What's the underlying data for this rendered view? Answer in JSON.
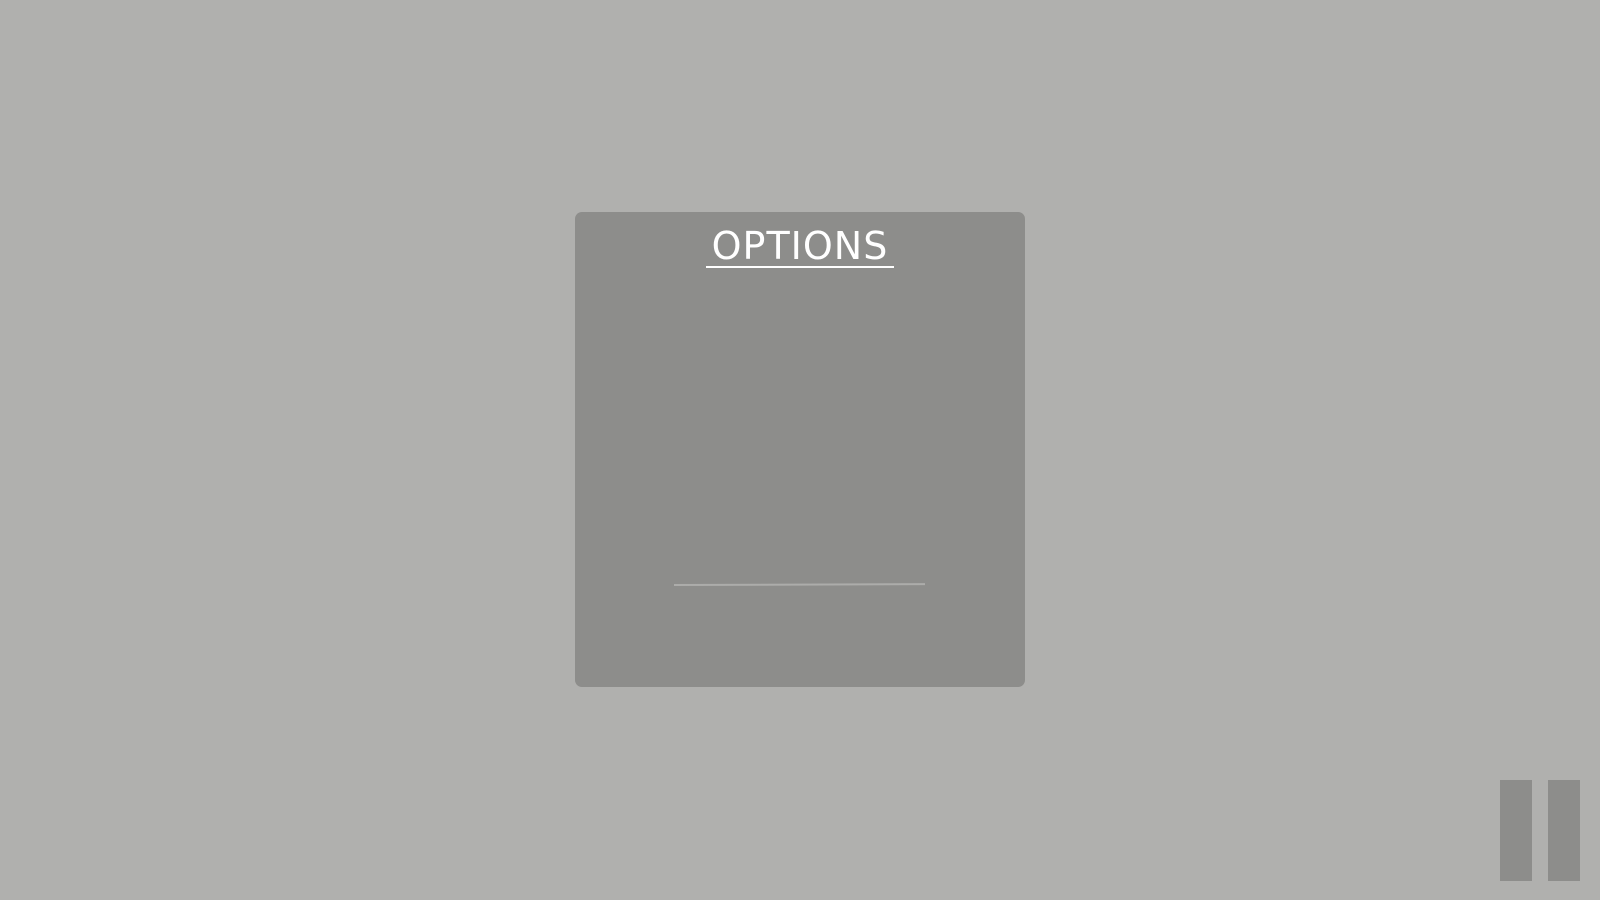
{
  "options_panel": {
    "title": "OPTIONS",
    "slider": {
      "value": null
    }
  },
  "pause_button": {
    "icon": "pause-icon"
  },
  "colors": {
    "background": "#b0b0ae",
    "panel": "#8d8d8b",
    "title_text": "#ffffff",
    "slider_track": "#acacaa",
    "pause_icon": "#8d8d8b"
  }
}
